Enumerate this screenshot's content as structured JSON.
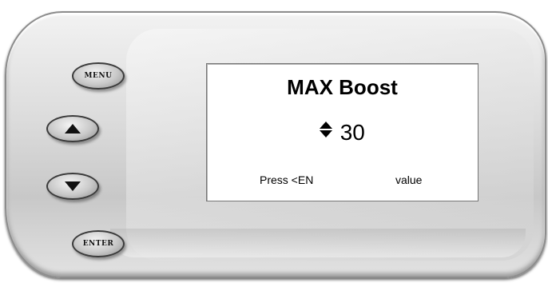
{
  "device": {
    "buttons": {
      "menu_label": "MENU",
      "enter_label": "ENTER",
      "up_icon": "triangle-up",
      "down_icon": "triangle-down"
    }
  },
  "screen": {
    "title": "MAX Boost",
    "value_icon": "up-down-arrows",
    "value": "30",
    "footer_left": "Press <EN",
    "footer_right": "value"
  }
}
